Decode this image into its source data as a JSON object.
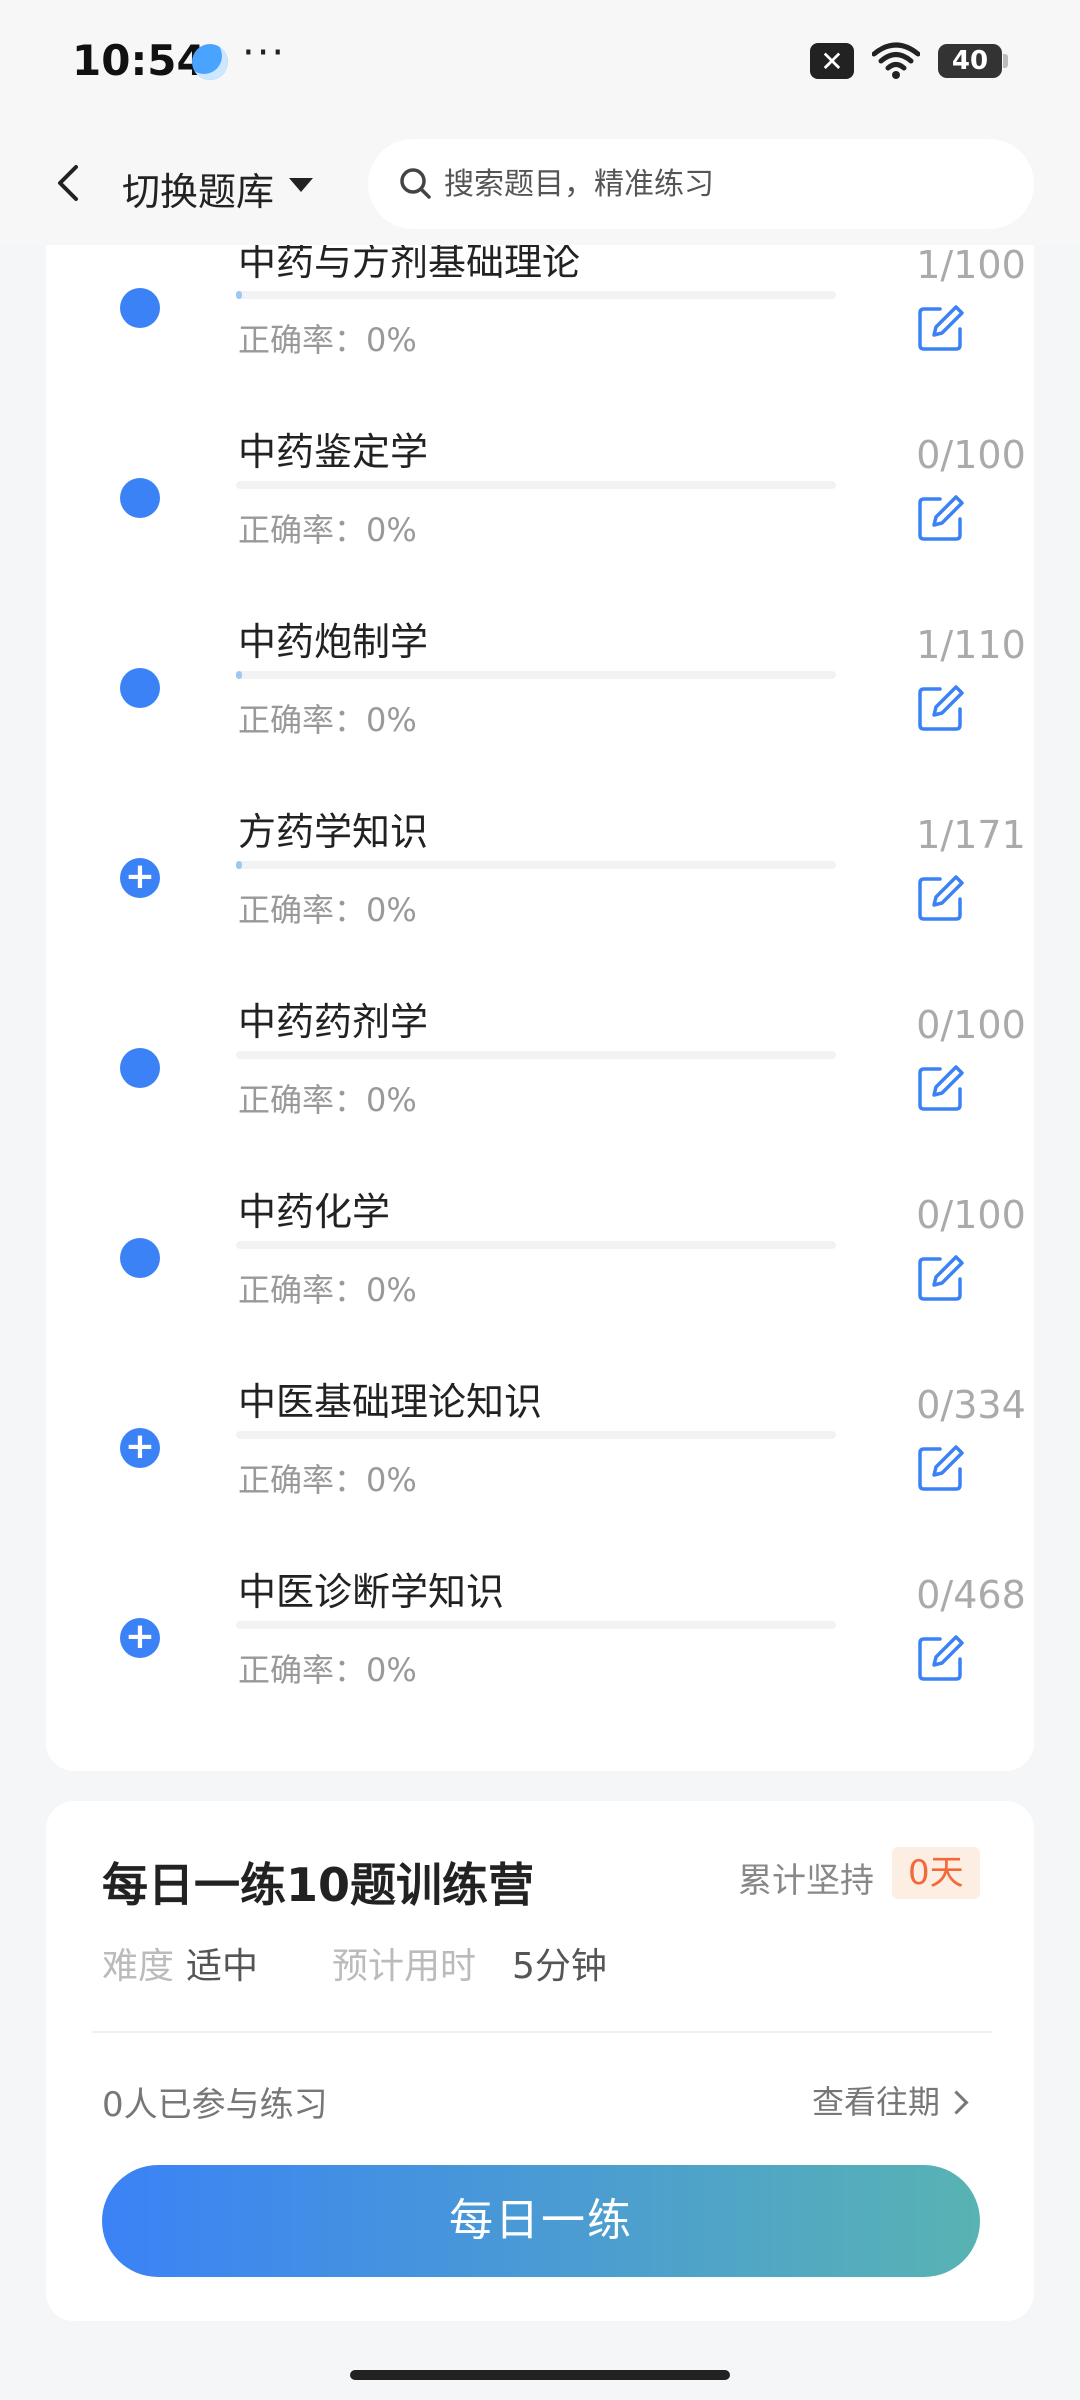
{
  "status_bar": {
    "time": "10:54",
    "more": "···",
    "battery": "40"
  },
  "header": {
    "title": "切换题库",
    "search_placeholder": "搜索题目，精准练习"
  },
  "items": [
    {
      "name": "中药与方剂基础理论",
      "rate": "正确率：0%",
      "count": "1/100",
      "progress": 0.01,
      "icon": "dot"
    },
    {
      "name": "中药鉴定学",
      "rate": "正确率：0%",
      "count": "0/100",
      "progress": 0,
      "icon": "dot"
    },
    {
      "name": "中药炮制学",
      "rate": "正确率：0%",
      "count": "1/110",
      "progress": 0.009,
      "icon": "dot"
    },
    {
      "name": "方药学知识",
      "rate": "正确率：0%",
      "count": "1/171",
      "progress": 0.006,
      "icon": "plus"
    },
    {
      "name": "中药药剂学",
      "rate": "正确率：0%",
      "count": "0/100",
      "progress": 0,
      "icon": "dot"
    },
    {
      "name": "中药化学",
      "rate": "正确率：0%",
      "count": "0/100",
      "progress": 0,
      "icon": "dot"
    },
    {
      "name": "中医基础理论知识",
      "rate": "正确率：0%",
      "count": "0/334",
      "progress": 0,
      "icon": "plus"
    },
    {
      "name": "中医诊断学知识",
      "rate": "正确率：0%",
      "count": "0/468",
      "progress": 0,
      "icon": "plus"
    }
  ],
  "daily": {
    "title": "每日一练10题训练营",
    "streak_label": "累计坚持",
    "streak_value": "0天",
    "difficulty_label": "难度",
    "difficulty_value": "适中",
    "time_label": "预计用时",
    "time_value": "5分钟",
    "participants": "0人已参与练习",
    "history_link": "查看往期",
    "button_label": "每日一练"
  },
  "colors": {
    "accent": "#3b82f6",
    "badge_bg": "#fdeee4",
    "badge_text": "#f26a3a"
  }
}
